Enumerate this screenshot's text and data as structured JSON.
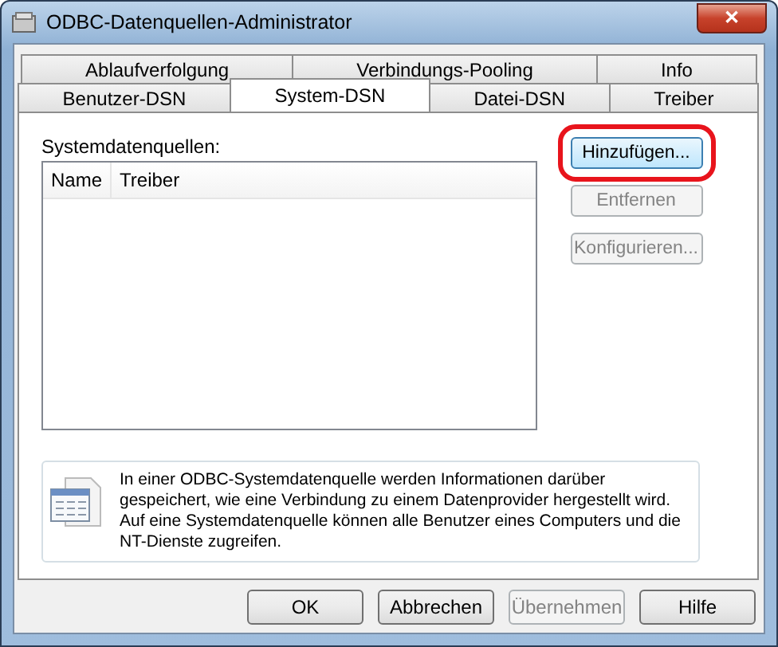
{
  "window": {
    "title": "ODBC-Datenquellen-Administrator",
    "close": "✕"
  },
  "tab_rows": [
    [
      {
        "label": "Ablaufverfolgung",
        "selected": false
      },
      {
        "label": "Verbindungs-Pooling",
        "selected": false
      },
      {
        "label": "Info",
        "selected": false
      }
    ],
    [
      {
        "label": "Benutzer-DSN",
        "selected": false
      },
      {
        "label": "System-DSN",
        "selected": true
      },
      {
        "label": "Datei-DSN",
        "selected": false
      },
      {
        "label": "Treiber",
        "selected": false
      }
    ]
  ],
  "list": {
    "label": "Systemdatenquellen:",
    "columns": [
      "Name",
      "Treiber"
    ]
  },
  "side_buttons": [
    {
      "label": "Hinzufügen...",
      "disabled": false,
      "highlighted": true
    },
    {
      "label": "Entfernen",
      "disabled": true,
      "highlighted": false
    },
    {
      "label": "Konfigurieren...",
      "disabled": true,
      "highlighted": false
    }
  ],
  "info": "In einer ODBC-Systemdatenquelle werden Informationen darüber gespeichert, wie eine Verbindung zu einem Datenprovider hergestellt wird. Auf eine Systemdatenquelle können alle Benutzer eines Computers und die NT-Dienste zugreifen.",
  "buttons": [
    {
      "label": "OK",
      "disabled": false
    },
    {
      "label": "Abbrechen",
      "disabled": false
    },
    {
      "label": "Übernehmen",
      "disabled": true
    },
    {
      "label": "Hilfe",
      "disabled": false
    }
  ]
}
